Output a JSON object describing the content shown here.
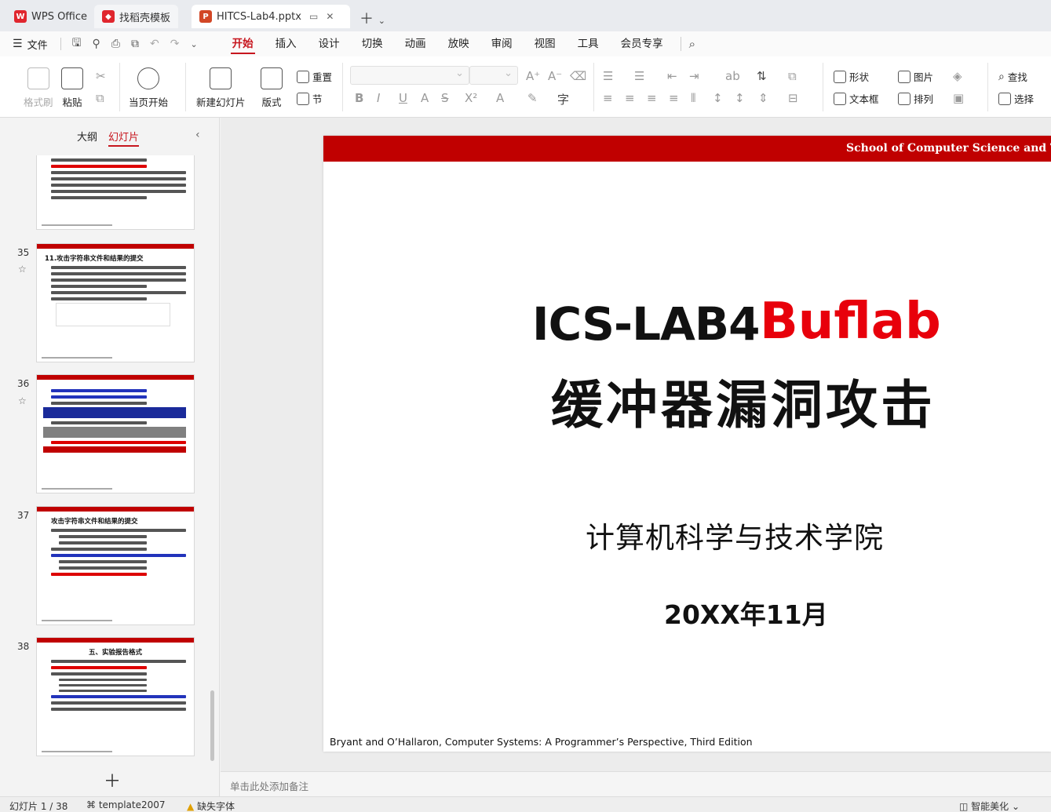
{
  "tabs": [
    {
      "label": "WPS Office",
      "icon": "wps-logo-icon"
    },
    {
      "label": "找稻壳模板",
      "icon": "docer-icon"
    },
    {
      "label": "HITCS-Lab4.pptx",
      "icon": "ppt-file-icon"
    }
  ],
  "menubar": {
    "file_label": "文件",
    "menus": [
      "开始",
      "插入",
      "设计",
      "切换",
      "动画",
      "放映",
      "审阅",
      "视图",
      "工具",
      "会员专享"
    ],
    "active_menu": "开始"
  },
  "ribbon": {
    "format_painter": "格式刷",
    "paste": "粘贴",
    "play_current": "当页开始",
    "new_slide": "新建幻灯片",
    "layout": "版式",
    "reset": "重置",
    "section": "节",
    "shape": "形状",
    "picture": "图片",
    "find": "查找",
    "textbox": "文本框",
    "arrange": "排列",
    "select": "选择"
  },
  "left_panel": {
    "tabs": [
      "大纲",
      "幻灯片"
    ],
    "active_tab": "幻灯片",
    "thumbnails": [
      {
        "number": "35",
        "title": "11.攻击字符串文件和结果的提交"
      },
      {
        "number": "36",
        "title": ""
      },
      {
        "number": "37",
        "title": "攻击字符串文件和结果的提交"
      },
      {
        "number": "38",
        "title": "五、实验报告格式"
      }
    ]
  },
  "slide": {
    "header": "School of Computer Science and Technology",
    "title_black": "ICS-LAB4",
    "title_red": "Buflab",
    "subtitle": "缓冲器漏洞攻击",
    "institute": "计算机科学与技术学院",
    "date": "20XX年11月",
    "footer": "Bryant and O’Hallaron, Computer Systems: A Programmer’s Perspective, Third Edition"
  },
  "notes_placeholder": "单击此处添加备注",
  "status": {
    "slide_counter": "幻灯片 1 / 38",
    "template": "template2007",
    "missing_font": "缺失字体",
    "smart_beautify": "智能美化"
  },
  "colors": {
    "accent": "#c7161e",
    "slide_bar": "#c00000",
    "title_red": "#e8000b"
  }
}
